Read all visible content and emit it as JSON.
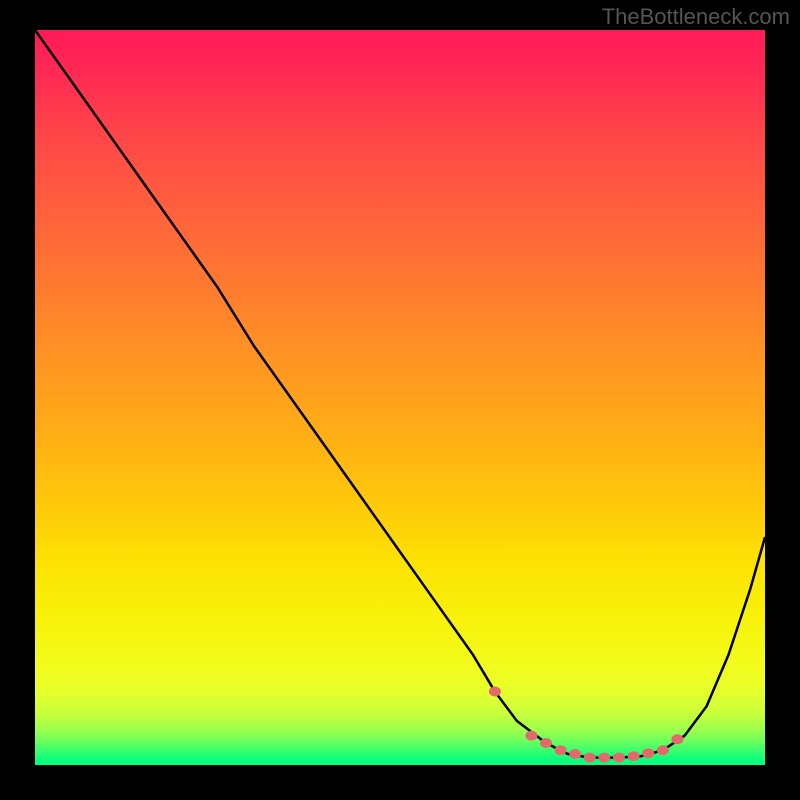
{
  "watermark": "TheBottleneck.com",
  "chart_data": {
    "type": "line",
    "title": "",
    "xlabel": "",
    "ylabel": "",
    "xlim": [
      0,
      100
    ],
    "ylim": [
      0,
      100
    ],
    "series": [
      {
        "name": "bottleneck-curve",
        "x": [
          0,
          5,
          10,
          15,
          20,
          25,
          30,
          35,
          40,
          45,
          50,
          55,
          60,
          63,
          66,
          70,
          73,
          76,
          80,
          83,
          86,
          89,
          92,
          95,
          98,
          100
        ],
        "values": [
          100,
          93,
          86,
          79,
          72,
          65,
          57,
          50,
          43,
          36,
          29,
          22,
          15,
          10,
          6,
          3,
          1.5,
          1.0,
          1.0,
          1.2,
          2,
          4,
          8,
          15,
          24,
          31
        ]
      }
    ],
    "markers": {
      "name": "curve-markers",
      "color": "#e36a6a",
      "x": [
        63,
        68,
        70,
        72,
        74,
        76,
        78,
        80,
        82,
        84,
        86,
        88
      ],
      "values": [
        10,
        4,
        3,
        2,
        1.5,
        1.0,
        1.0,
        1.0,
        1.2,
        1.6,
        2,
        3.5
      ]
    },
    "gradient_stops": [
      {
        "pos": 0,
        "color": "#ff1a58"
      },
      {
        "pos": 0.5,
        "color": "#ffc40c"
      },
      {
        "pos": 0.85,
        "color": "#f8f20a"
      },
      {
        "pos": 1.0,
        "color": "#00ff82"
      }
    ]
  }
}
